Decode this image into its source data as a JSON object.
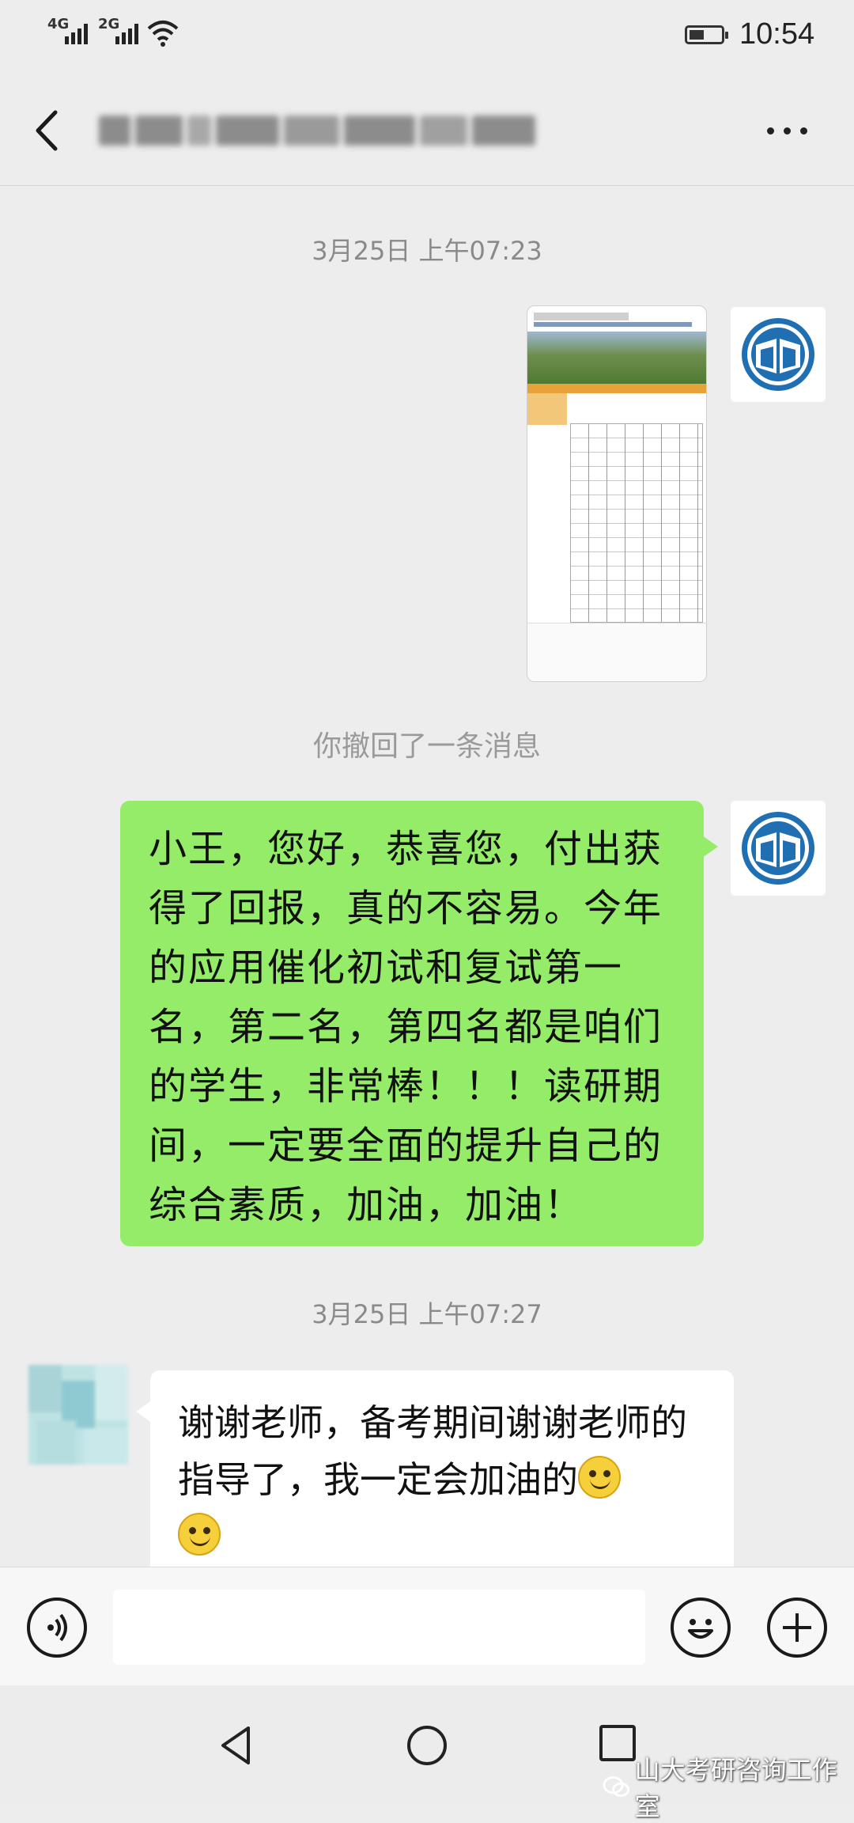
{
  "status_bar": {
    "sim1": "4G",
    "sim2": "2G",
    "time": "10:54"
  },
  "header": {
    "back_icon": "chevron-left-icon",
    "more_icon": "more-horizontal-icon"
  },
  "messages": [
    {
      "type": "timestamp",
      "text": "3月25日 上午07:23"
    },
    {
      "type": "image",
      "sender": "self"
    },
    {
      "type": "system",
      "text": "你撤回了一条消息"
    },
    {
      "type": "text",
      "sender": "self",
      "text": "小王，您好，恭喜您，付出获得了回报，真的不容易。今年的应用催化初试和复试第一名，第二名，第四名都是咱们的学生，非常棒！！！读研期间，一定要全面的提升自己的综合素质，加油，加油！"
    },
    {
      "type": "timestamp",
      "text": "3月25日 上午07:27"
    },
    {
      "type": "text",
      "sender": "other",
      "text": "谢谢老师，备考期间谢谢老师的指导了，我一定会加油的"
    }
  ],
  "input_bar": {
    "voice_icon": "voice-icon",
    "emoji_icon": "emoji-icon",
    "add_icon": "plus-icon",
    "value": ""
  },
  "watermark": "山大考研咨询工作室",
  "colors": {
    "self_bubble": "#95ec69",
    "other_bubble": "#ffffff",
    "background": "#ededed"
  }
}
